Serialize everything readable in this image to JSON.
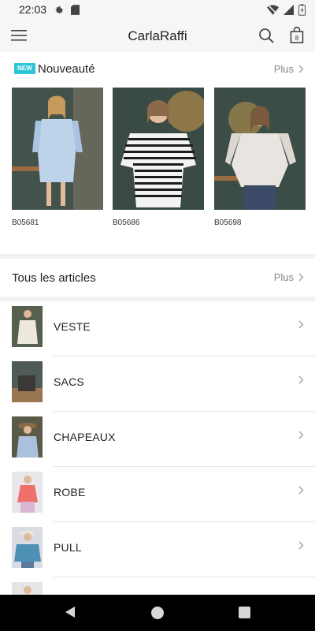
{
  "status_bar": {
    "time": "22:03",
    "icons": [
      "settings-icon",
      "sd-card-icon",
      "wifi-off-icon",
      "signal-icon",
      "battery-icon"
    ]
  },
  "app_bar": {
    "title": "CarlaRaffi",
    "bag_count": "8",
    "icons": [
      "menu-icon",
      "search-icon",
      "shopping-bag-icon"
    ]
  },
  "new_section": {
    "badge": "NEW",
    "title": "Nouveauté",
    "more_label": "Plus",
    "products": [
      {
        "code": "B05681"
      },
      {
        "code": "B05686"
      },
      {
        "code": "B05698"
      }
    ]
  },
  "all_section": {
    "title": "Tous les articles",
    "more_label": "Plus"
  },
  "categories": [
    {
      "label": "VESTE"
    },
    {
      "label": "SACS"
    },
    {
      "label": "CHAPEAUX"
    },
    {
      "label": "ROBE"
    },
    {
      "label": "PULL"
    }
  ],
  "colors": {
    "accent_badge": "#2ec5d6",
    "background": "#f2f2f2",
    "nav_bar": "#000000"
  }
}
